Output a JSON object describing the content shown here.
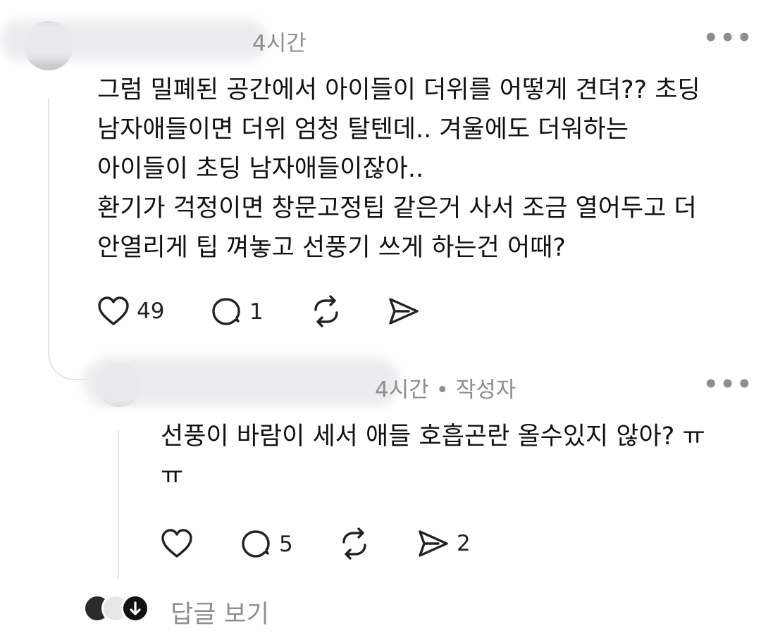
{
  "comment": {
    "time": "4시간",
    "lines": [
      "그럼 밀폐된 공간에서 아이들이 더위를 어떻게 견뎌?? 초딩",
      "남자애들이면 더위 엄청 탈텐데.. 겨울에도 더워하는",
      "아이들이 초딩 남자애들이잖아..",
      "환기가 걱정이면 창문고정팁 같은거 사서 조금 열어두고 더",
      "안열리게 팁 껴놓고 선풍기 쓰게 하는건 어때?"
    ],
    "likes": "49",
    "replies": "1",
    "more": "•••"
  },
  "reply": {
    "time": "4시간 • 작성자",
    "lines": [
      "선풍이 바람이 세서 애들 호흡곤란 올수있지 않아? ㅠ",
      "ㅠ"
    ],
    "replies": "5",
    "shares": "2",
    "more": "•••"
  },
  "footer": {
    "view_replies": "답글 보기"
  },
  "icons": [
    "heart-icon",
    "comment-icon",
    "repost-icon",
    "share-icon",
    "arrow-down-icon"
  ],
  "colors": {
    "meta": "#8e8e8e",
    "line": "#e3e3e3",
    "text": "#111111"
  }
}
